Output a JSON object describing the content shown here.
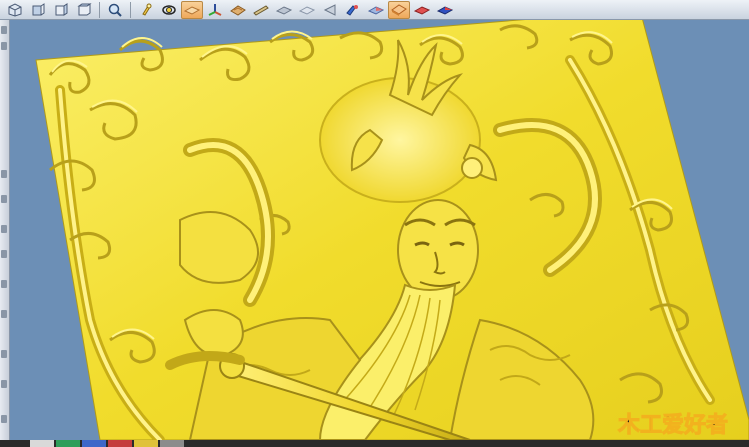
{
  "toolbar": {
    "buttons": [
      {
        "icon": "cube-view-icon",
        "active": false
      },
      {
        "icon": "cube-front-icon",
        "active": false
      },
      {
        "icon": "cube-side-icon",
        "active": false
      },
      {
        "icon": "cube-top-icon",
        "active": false
      },
      {
        "icon": "zoom-icon",
        "active": false
      },
      {
        "icon": "light-icon",
        "active": false
      },
      {
        "icon": "rotate-icon",
        "active": false
      },
      {
        "icon": "shade-plane-icon",
        "active": true
      },
      {
        "icon": "axis-icon",
        "active": false
      },
      {
        "icon": "material-icon",
        "active": false
      },
      {
        "icon": "pencil-icon",
        "active": false
      },
      {
        "icon": "plane-grey-icon",
        "active": false
      },
      {
        "icon": "plane-light-icon",
        "active": false
      },
      {
        "icon": "shade-left-icon",
        "active": false
      },
      {
        "icon": "model-blue-icon",
        "active": false
      },
      {
        "icon": "model-blue-red-icon",
        "active": false
      },
      {
        "icon": "shaded-plane-active-icon",
        "active": true
      },
      {
        "icon": "red-plane-icon",
        "active": false
      },
      {
        "icon": "red-blue-plane-icon",
        "active": false
      }
    ]
  },
  "viewport": {
    "relief_color": "#f4e23a",
    "relief_shadow_color": "#a99313",
    "background_color": "#6c8fb6"
  },
  "watermark": {
    "logo_text": "木工爱好者"
  },
  "palette": {
    "colors": [
      "#d9d9d9",
      "#2e9e5a",
      "#3d67c9",
      "#c43c3c",
      "#e0c23a",
      "#8c8c8c"
    ]
  }
}
